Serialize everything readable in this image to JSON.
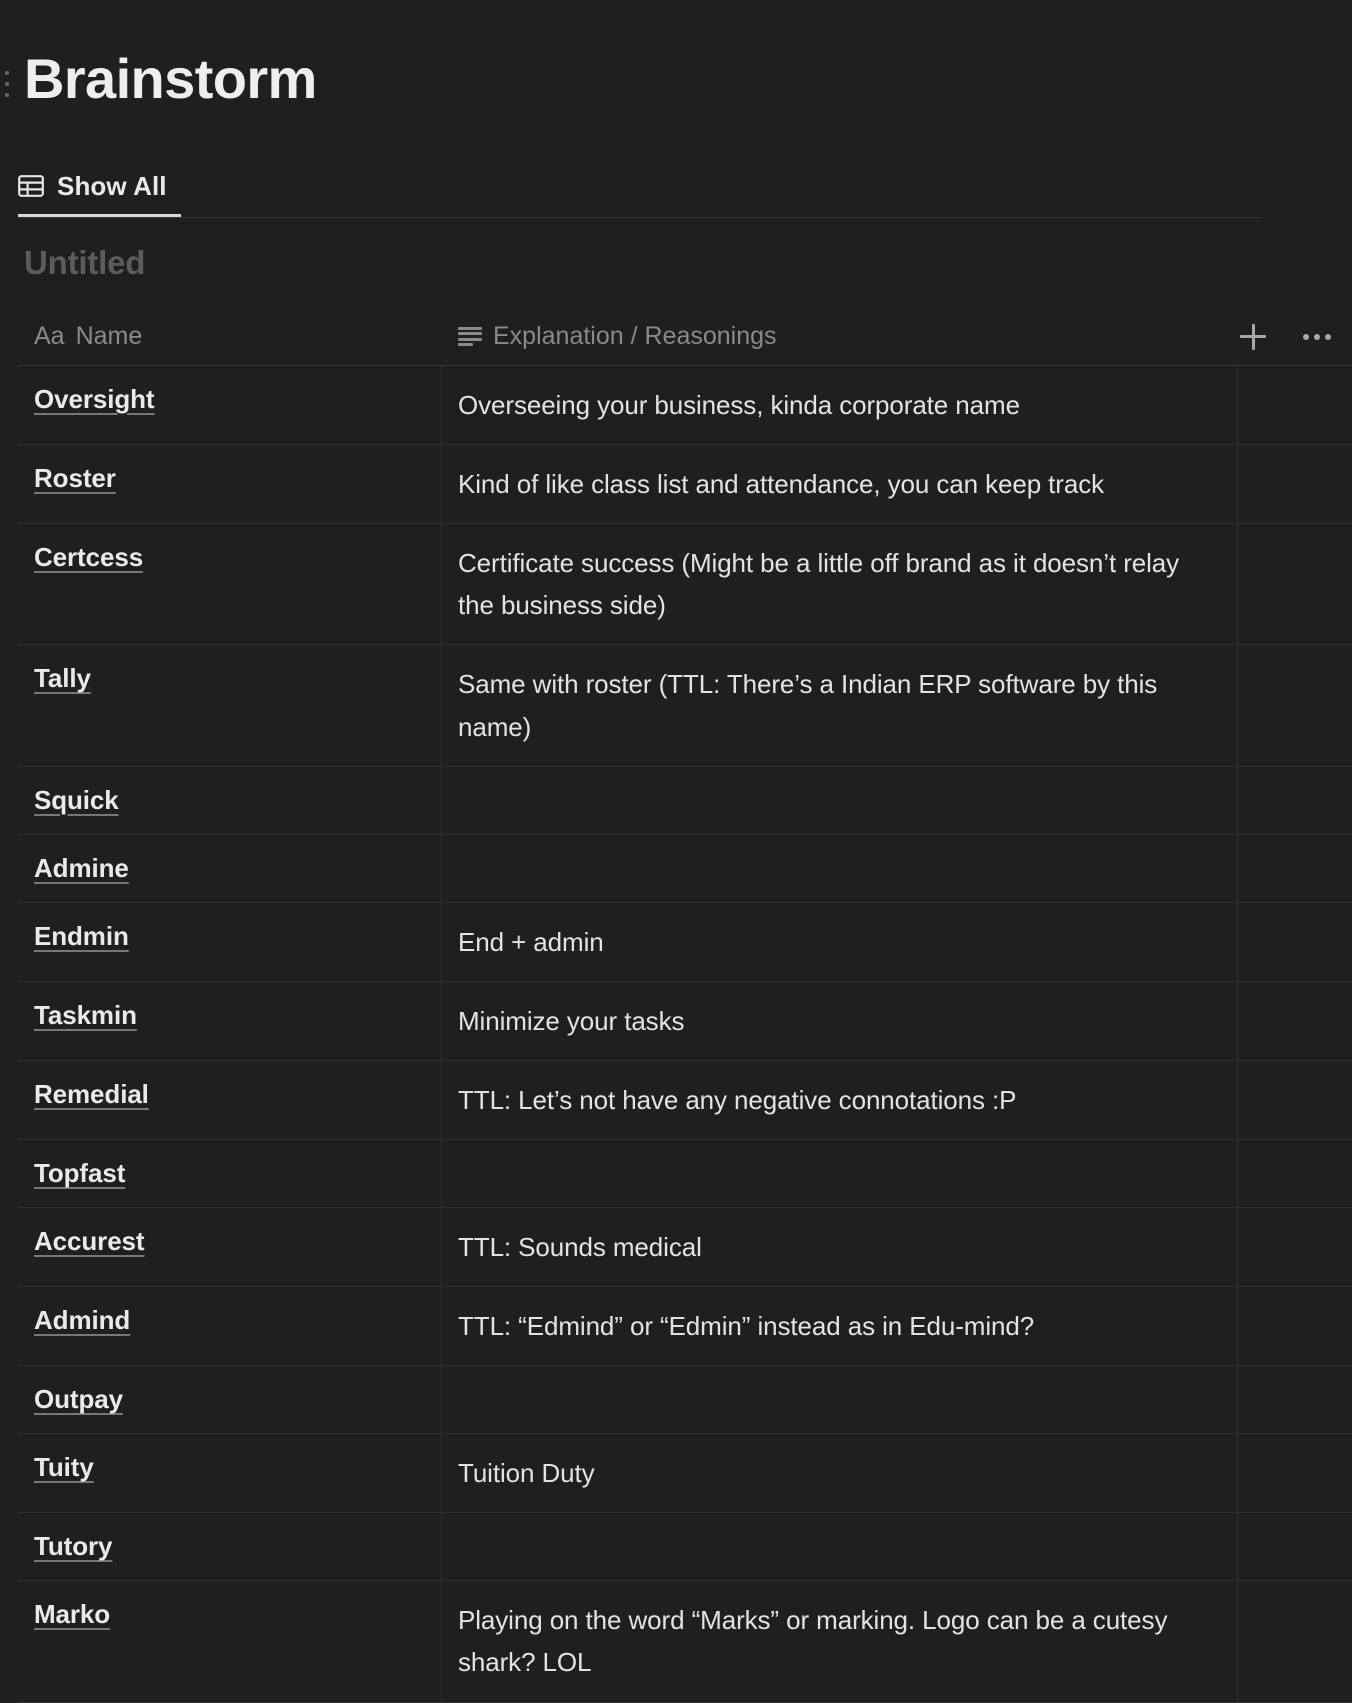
{
  "page": {
    "title": "Brainstorm",
    "drag_handle_icon": "drag-handle-icon"
  },
  "view_bar": {
    "tabs": [
      {
        "label": "Show All",
        "icon": "table-icon",
        "active": true
      }
    ]
  },
  "database": {
    "title": "Untitled",
    "columns": [
      {
        "key": "name",
        "label": "Name",
        "icon": "aa-title-icon",
        "icon_text": "Aa"
      },
      {
        "key": "explanation",
        "label": "Explanation / Reasonings",
        "icon": "text-lines-icon"
      },
      {
        "key": "blank",
        "label": "",
        "icon": ""
      }
    ],
    "header_actions": [
      {
        "name": "add-property-button",
        "icon": "plus-icon"
      },
      {
        "name": "more-options-button",
        "icon": "ellipsis-icon"
      }
    ],
    "rows": [
      {
        "name": "Oversight",
        "explanation": "Overseeing your business, kinda corporate name",
        "lines": 1
      },
      {
        "name": "Roster",
        "explanation": "Kind of like class list and attendance, you can keep track",
        "lines": 1
      },
      {
        "name": "Certcess",
        "explanation": "Certificate success (Might be a little off brand as it doesn’t relay the business side)",
        "lines": 2
      },
      {
        "name": "Tally",
        "explanation": "Same with roster (TTL: There’s a Indian ERP software by this name)",
        "lines": 2
      },
      {
        "name": "Squick",
        "explanation": "",
        "lines": 1
      },
      {
        "name": "Admine",
        "explanation": "",
        "lines": 1
      },
      {
        "name": "Endmin",
        "explanation": "End + admin",
        "lines": 1
      },
      {
        "name": "Taskmin",
        "explanation": "Minimize your tasks",
        "lines": 1
      },
      {
        "name": "Remedial",
        "explanation": "TTL: Let’s not have any negative connotations :P",
        "lines": 1
      },
      {
        "name": "Topfast",
        "explanation": "",
        "lines": 1
      },
      {
        "name": "Accurest",
        "explanation": "TTL: Sounds medical",
        "lines": 1
      },
      {
        "name": "Admind",
        "explanation": "TTL: “Edmind” or “Edmin” instead as in Edu-mind?",
        "lines": 1
      },
      {
        "name": "Outpay",
        "explanation": "",
        "lines": 1
      },
      {
        "name": "Tuity",
        "explanation": "Tuition Duty",
        "lines": 1
      },
      {
        "name": "Tutory",
        "explanation": "",
        "lines": 1
      },
      {
        "name": "Marko",
        "explanation": "Playing on the word “Marks” or marking. Logo can be a cutesy shark? LOL",
        "lines": 2
      }
    ]
  },
  "colors": {
    "background": "#1f1f1f",
    "text_primary": "#e8e8e8",
    "text_muted": "#8a8a8a",
    "title_muted": "#5c5c5c",
    "divider": "#303030",
    "tab_underline": "#d8d8d8"
  }
}
